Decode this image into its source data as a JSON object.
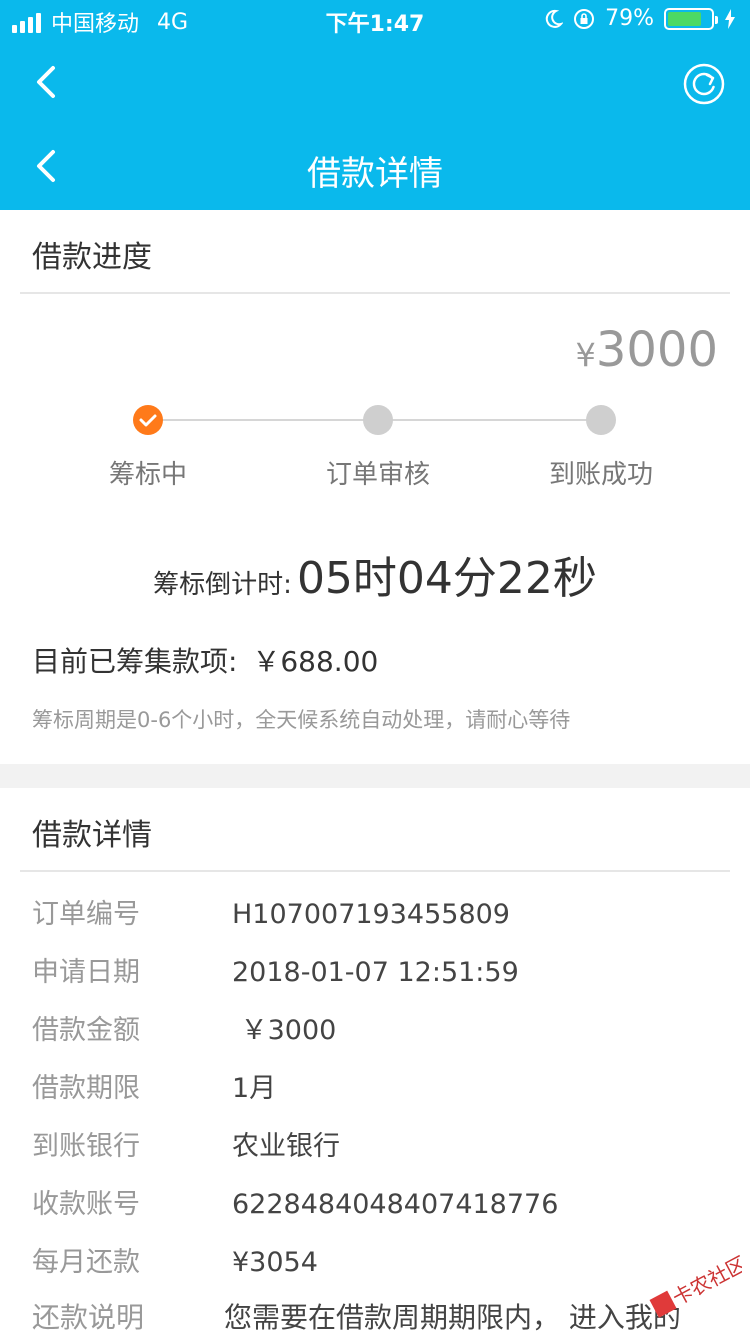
{
  "status_bar": {
    "carrier": "中国移动",
    "network": "4G",
    "time": "下午1:47",
    "battery_percent": "79%",
    "battery_level": 0.79,
    "battery_color": "#4cd964"
  },
  "nav": {
    "title": "借款详情",
    "back_icon": "chevron-left-icon",
    "refresh_icon": "refresh-icon",
    "accent_color": "#0ab9ec"
  },
  "progress_section": {
    "title": "借款进度",
    "amount_currency": "¥",
    "amount": "3000",
    "steps": [
      {
        "label": "筹标中",
        "active": true
      },
      {
        "label": "订单审核",
        "active": false
      },
      {
        "label": "到账成功",
        "active": false
      }
    ],
    "countdown_label": "筹标倒计时:",
    "countdown_value": "05时04分22秒",
    "raised_label": "目前已筹集款项:",
    "raised_value": "￥688.00",
    "note": "筹标周期是0-6个小时，全天候系统自动处理，请耐心等待"
  },
  "details_section": {
    "title": "借款详情",
    "rows": [
      {
        "label": "订单编号",
        "value": "H107007193455809"
      },
      {
        "label": "申请日期",
        "value": "2018-01-07 12:51:59"
      },
      {
        "label": "借款金额",
        "value": " ￥3000"
      },
      {
        "label": "借款期限",
        "value": "1月"
      },
      {
        "label": "到账银行",
        "value": "农业银行"
      },
      {
        "label": "收款账号",
        "value": "6228484048407418776"
      },
      {
        "label": "每月还款",
        "value": "¥3054"
      },
      {
        "label": "还款说明",
        "value": "您需要在借款周期期限内， 进入我的"
      }
    ]
  },
  "watermark": {
    "text": "卡农社区"
  }
}
